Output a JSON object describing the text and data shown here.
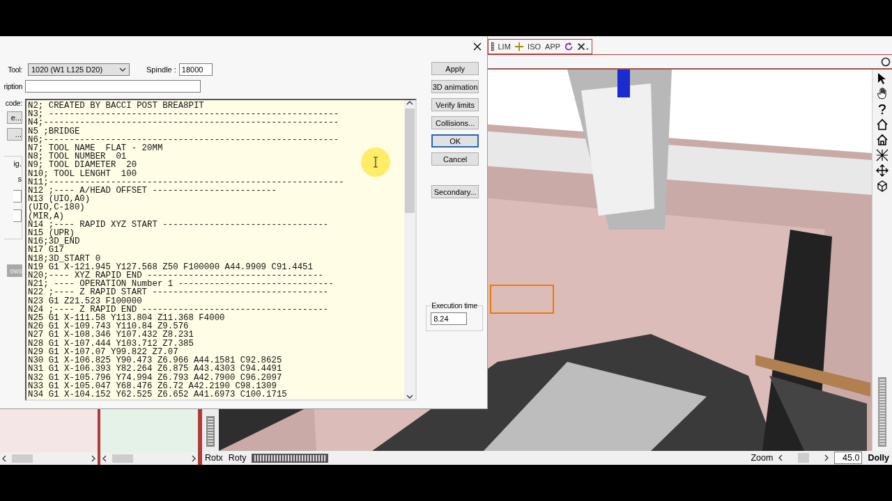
{
  "dialog": {
    "tool": {
      "label": "Tool:",
      "value": "1020  (W1 L125 D20)"
    },
    "spindle": {
      "label": "Spindle :",
      "value": "18000"
    },
    "description": {
      "label": "ription"
    },
    "code": {
      "label": "code:",
      "lines": [
        "N2; CREATED BY BACCI POST BREA8PIT",
        "N3; --------------------------------------------------------",
        "N4;---------------------------------------------------------",
        "N5 ;BRIDGE",
        "N6;---------------------------------------------------------",
        "N7; TOOL NAME  FLAT - 20MM",
        "N8; TOOL NUMBER  01",
        "N9; TOOL DIAMETER  20",
        "N10; TOOL LENGHT  100",
        "N11;---------------------------------------------------------",
        "N12 ;---- A/HEAD OFFSET ------------------------",
        "N13 (UIO,A0)",
        "(UIO,C-180)",
        "(MIR,A)",
        "N14 ;---- RAPID XYZ START --------------------------------",
        "N15 (UPR)",
        "N16;3D_END",
        "N17 G17",
        "N18;3D_START 0",
        "N19 G1 X-121.945 Y127.568 Z50 F100000 A44.9909 C91.4451",
        "N20;---- XYZ RAPID END ----------------------------------",
        "N21; ---- OPERATION Number 1 ------------------------------",
        "N22 ;---- Z RAPID START ----------------------------------",
        "N23 G1 Z21.523 F100000",
        "N24 ;---- Z RAPID END ------------------------------------",
        "N25 G1 X-111.58 Y113.804 Z11.368 F4000",
        "N26 G1 X-109.743 Y110.84 Z9.576",
        "N27 G1 X-108.346 Y107.432 Z8.231",
        "N28 G1 X-107.444 Y103.712 Z7.385",
        "N29 G1 X-107.07 Y99.822 Z7.07",
        "N30 G1 X-106.825 Y90.473 Z6.966 A44.1581 C92.8625",
        "N31 G1 X-106.393 Y82.264 Z6.875 A43.4303 C94.4491",
        "N32 G1 X-105.796 Y74.994 Z6.793 A42.7900 C96.2097",
        "N33 G1 X-105.047 Y68.476 Z6.72 A42.2190 C98.1309",
        "N34 G1 X-104.152 Y62.525 Z6.652 A41.6973 C100.1715"
      ]
    },
    "side_buttons": [
      "e...",
      "..."
    ],
    "group": {
      "label": "ig.",
      "sub_label": "s",
      "button": "ows"
    },
    "buttons": [
      {
        "label": "Apply",
        "default": false
      },
      {
        "label": "3D animation",
        "default": false
      },
      {
        "label": "Verify limits",
        "default": false
      },
      {
        "label": "Collisions...",
        "default": false
      },
      {
        "label": "OK",
        "default": true
      },
      {
        "label": "Cancel",
        "default": false
      }
    ],
    "secondary": "Secondary...",
    "execution_time": {
      "label": "Execution time",
      "value": "8.24"
    }
  },
  "toolbar": {
    "labels": [
      "LIM",
      "ISO",
      "APP"
    ]
  },
  "status_bar": {
    "rotx": "Rotx",
    "roty": "Roty",
    "zoom": "Zoom",
    "zoom_value": "45.0",
    "dolly": "Dolly"
  }
}
